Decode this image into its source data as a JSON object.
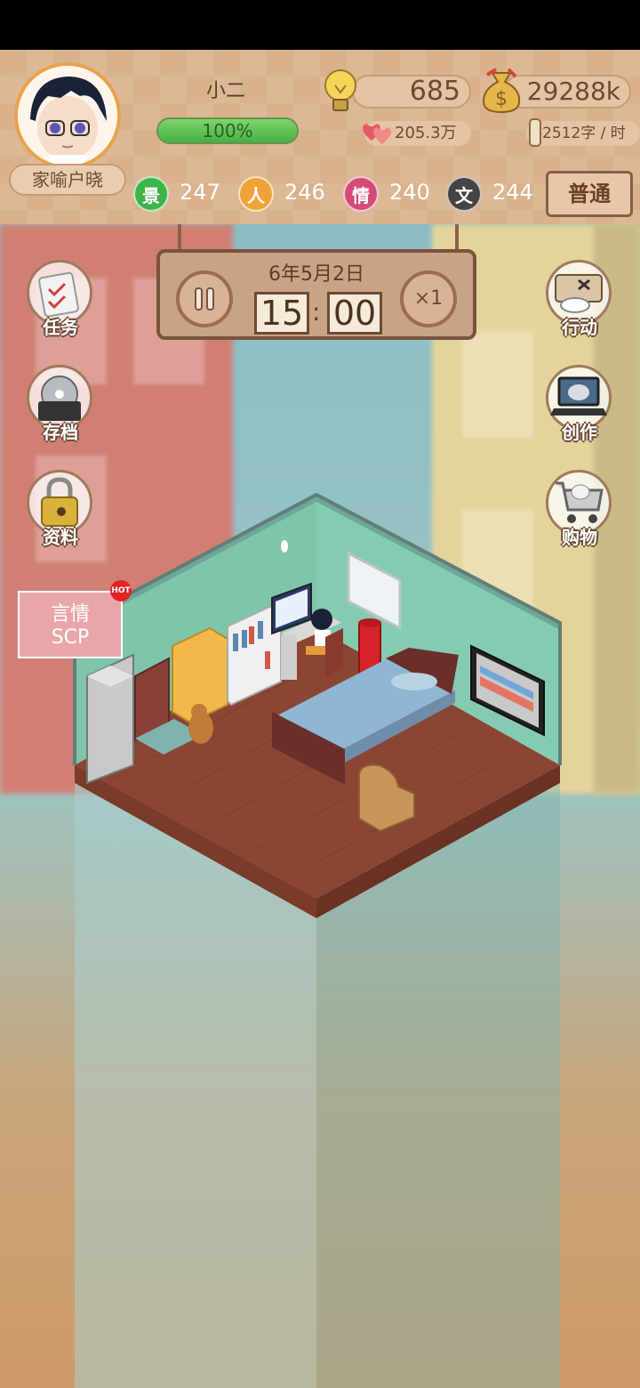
{
  "player": {
    "account_name": "家喻户晓",
    "character_name": "小二",
    "energy_percent": 100,
    "energy_label": "100%"
  },
  "resources": {
    "ideas": "685",
    "money": "29288k",
    "fans": "205.3万",
    "writing_speed": "2512字 / 时"
  },
  "stats": [
    {
      "char": "景",
      "value": "247",
      "color": "#3fb44a"
    },
    {
      "char": "人",
      "value": "246",
      "color": "#f0a23a"
    },
    {
      "char": "情",
      "value": "240",
      "color": "#d54b78"
    },
    {
      "char": "文",
      "value": "244",
      "color": "#444444"
    }
  ],
  "mode_button": "普通",
  "timer": {
    "date": "6年5月2日",
    "hour": "15",
    "minute": "00",
    "speed": "×1",
    "pause_icon": "pause-icon"
  },
  "left_menu": [
    {
      "label": "任务",
      "icon": "task-clipboard-icon"
    },
    {
      "label": "存档",
      "icon": "save-disc-icon"
    },
    {
      "label": "资料",
      "icon": "profile-lock-icon"
    }
  ],
  "right_menu": [
    {
      "label": "行动",
      "icon": "action-bag-icon"
    },
    {
      "label": "创作",
      "icon": "laptop-icon"
    },
    {
      "label": "购物",
      "icon": "shopping-cart-icon"
    }
  ],
  "promo": {
    "line1": "言情",
    "line2": "SCP",
    "badge": "HOT"
  },
  "colors": {
    "hud_bg": "#d9b28d",
    "accent_brown": "#6b4a36",
    "energy_green": "#46b043"
  }
}
